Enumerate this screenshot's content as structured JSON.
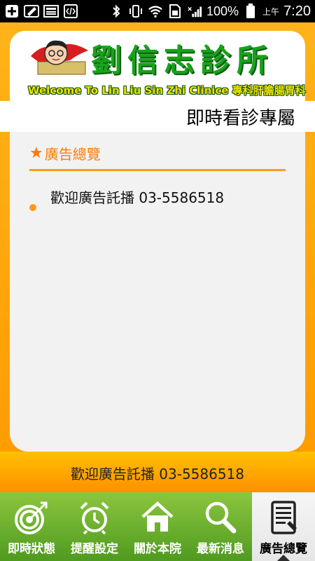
{
  "status_bar": {
    "left_icons": [
      "add-icon",
      "edit-icon",
      "image-icon",
      "code-icon"
    ],
    "right_icons": [
      "bluetooth-icon",
      "vibrate-icon",
      "wifi-icon",
      "sim-icon",
      "signal-icon",
      "battery-icon"
    ],
    "battery": "100%",
    "time_prefix": "上午",
    "time": "7:20"
  },
  "header": {
    "clinic_name": "劉信志診所",
    "welcome_line": "Welcome To Lin Liu Sin Zhi Clinice 專科肝膽腸胃科"
  },
  "marquee": "即時看診專屬",
  "section": {
    "title": "廣告總覽"
  },
  "list": [
    {
      "text": "歡迎廣告託播 03-5586518"
    }
  ],
  "footer": {
    "text": "歡迎廣告託播 03-5586518"
  },
  "nav": [
    {
      "label": "即時狀態",
      "icon": "target-icon"
    },
    {
      "label": "提醒設定",
      "icon": "alarm-clock-icon"
    },
    {
      "label": "關於本院",
      "icon": "home-icon"
    },
    {
      "label": "最新消息",
      "icon": "magnifier-icon"
    },
    {
      "label": "廣告總覽",
      "icon": "tablet-icon",
      "active": true
    }
  ],
  "colors": {
    "accent_orange": "#ff9a00",
    "nav_green": "#6bb22f",
    "title_green": "#18a21d"
  }
}
